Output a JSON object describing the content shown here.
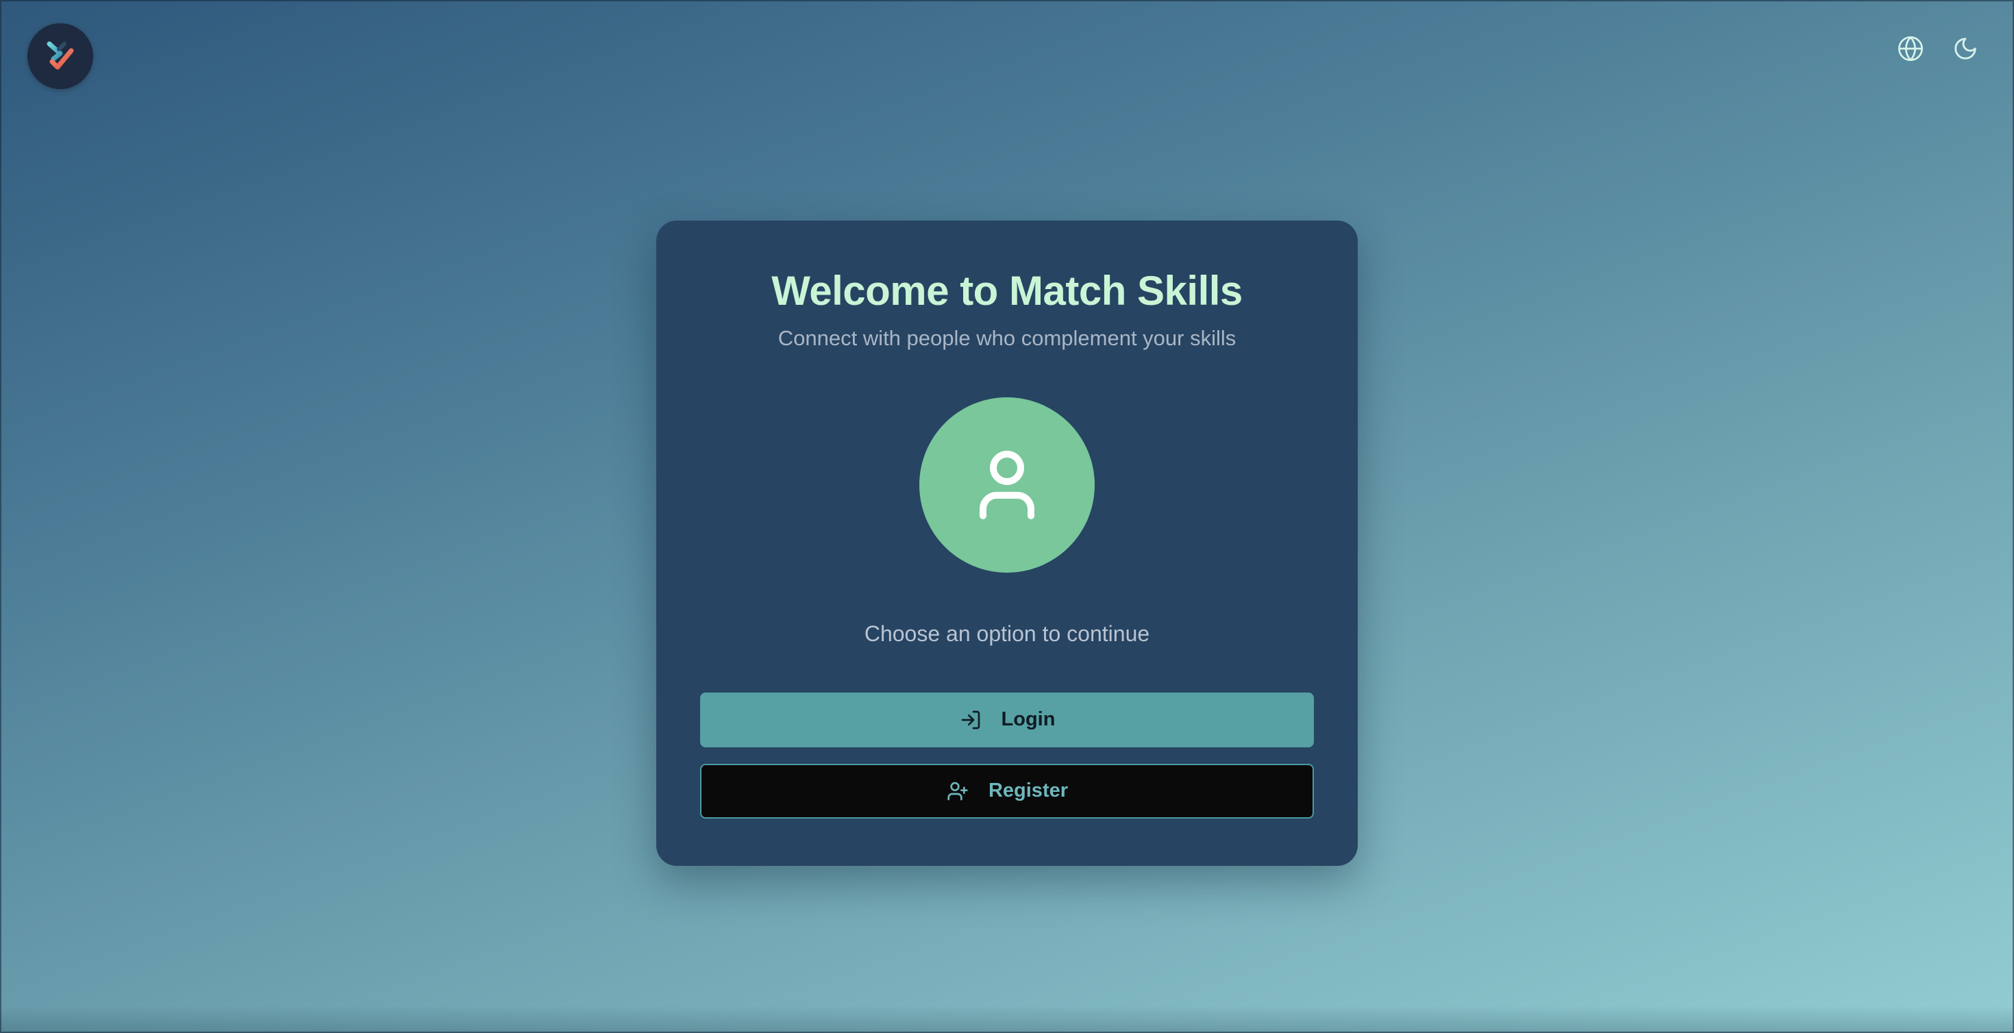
{
  "header": {
    "logo_icon": "match-skills-logo-icon",
    "language_icon": "globe-icon",
    "theme_icon": "moon-icon"
  },
  "card": {
    "title": "Welcome to Match Skills",
    "subtitle": "Connect with people who complement your skills",
    "avatar_icon": "user-icon",
    "prompt": "Choose an option to continue",
    "login": {
      "label": "Login",
      "icon": "log-in-icon"
    },
    "register": {
      "label": "Register",
      "icon": "user-plus-icon"
    }
  },
  "colors": {
    "card_background": "#274462",
    "title": "#c9f5d6",
    "avatar": "#79c79b",
    "login_button": "#57a1a5",
    "register_button": "#0a0a0b",
    "register_text": "#6fb6bc"
  }
}
